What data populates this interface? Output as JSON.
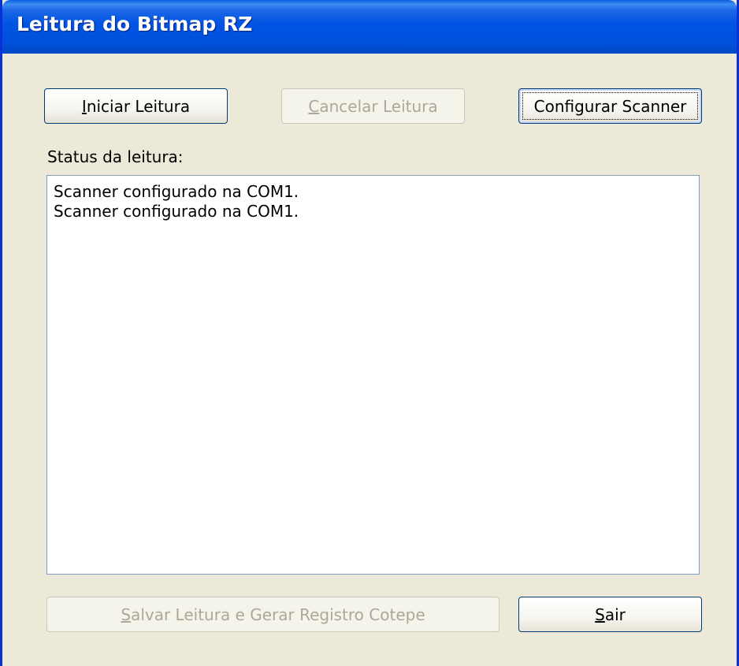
{
  "window": {
    "title": "Leitura do Bitmap RZ"
  },
  "buttons": {
    "start": {
      "mnemonic": "I",
      "rest": "niciar Leitura"
    },
    "cancel": {
      "mnemonic": "C",
      "rest": "ancelar Leitura"
    },
    "configure": {
      "label": "Configurar Scanner"
    },
    "save": {
      "mnemonic": "S",
      "rest": "alvar Leitura e Gerar Registro Cotepe"
    },
    "exit": {
      "mnemonic": "S",
      "rest": "air"
    }
  },
  "status": {
    "label": "Status da leitura:",
    "lines": [
      "Scanner configurado na COM1.",
      "Scanner configurado na COM1."
    ]
  },
  "colors": {
    "titlebar": "#0054e3",
    "dialog_bg": "#ece9d8",
    "button_border": "#003c74",
    "disabled_text": "#aca899"
  }
}
